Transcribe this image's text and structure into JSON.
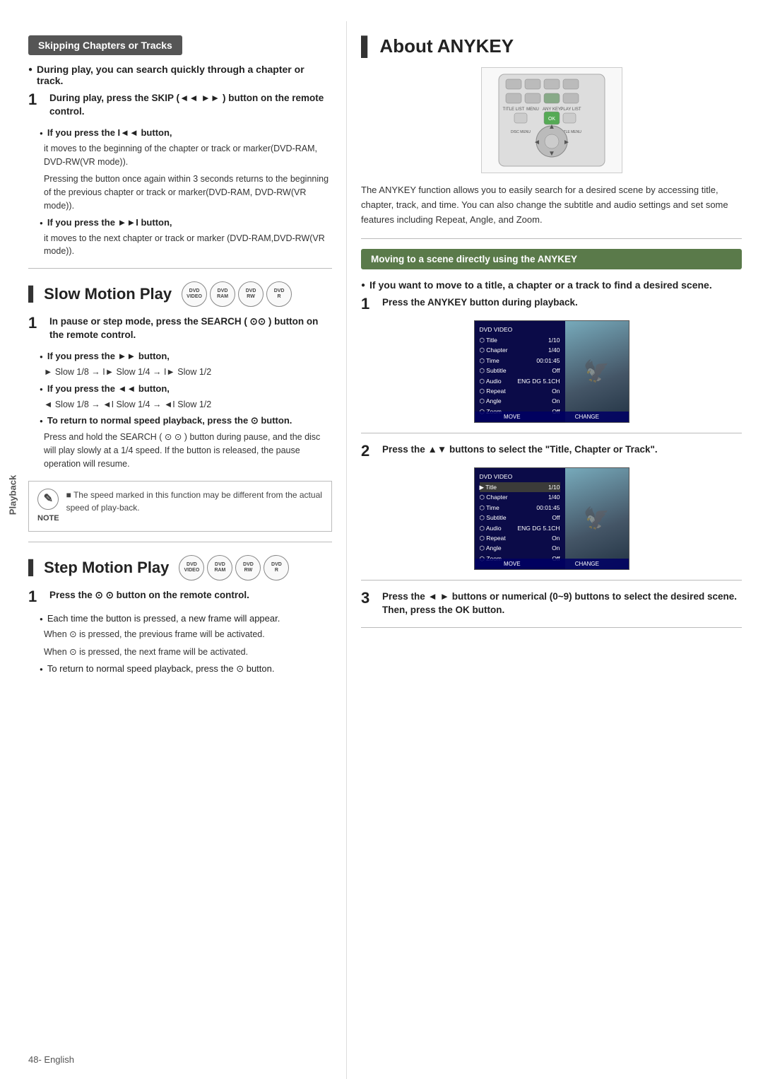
{
  "page": {
    "footer": "48- English",
    "sidebar": "Playback"
  },
  "left": {
    "section1": {
      "header": "Skipping Chapters or Tracks",
      "bullet1": "During play, you can search quickly through a chapter or track.",
      "step1": {
        "num": "1",
        "text_bold": "During play, press the SKIP (◄◄ ►► ) button on the remote control.",
        "sub1_label": "If you press the I◄◄ button,",
        "sub1_text1": "it moves to the beginning of the chapter or track or marker(DVD-RAM, DVD-RW(VR mode)).",
        "sub1_text2": "Pressing the button once again within 3 seconds returns to the beginning of the previous chapter or track or marker(DVD-RAM, DVD-RW(VR mode)).",
        "sub2_label": "If you press the ►►I button,",
        "sub2_text": "it moves to the next chapter or track or marker (DVD-RAM,DVD-RW(VR mode))."
      }
    },
    "section2": {
      "title": "Slow Motion Play",
      "disc_labels": [
        "DVD-VIDEO",
        "DVD-RAM",
        "DVD-RW",
        "DVD-R"
      ],
      "step1": {
        "num": "1",
        "text": "In pause or step mode, press the SEARCH ( ⊙⊙ ) button on the remote control.",
        "sub1_label": "If you press the ►► button,",
        "sub1_text": "► Slow 1/8 → I► Slow 1/4 → I► Slow 1/2",
        "sub2_label": "If you press the ◄◄ button,",
        "sub2_text": "◄ Slow 1/8 → ◄I Slow 1/4 → ◄I Slow 1/2",
        "sub3_label": "To return to normal speed playback, press the ⊙ button."
      },
      "body_text": "Press and hold the SEARCH ( ⊙ ⊙ ) button during pause, and the disc will play slowly at a 1/4 speed. If the button is released, the pause operation will resume.",
      "note": {
        "icon": "✎",
        "label": "NOTE",
        "bullet1": "The speed marked in this function may be different from the actual speed of play-back."
      }
    },
    "section3": {
      "title": "Step Motion Play",
      "disc_labels": [
        "DVD-VIDEO",
        "DVD-RAM",
        "DVD-RW",
        "DVD-R"
      ],
      "step1": {
        "num": "1",
        "text": "Press the ⊙ ⊙ button on the remote control.",
        "sub1_text1": "Each time the button is pressed, a new frame will appear.",
        "sub1_text2": "When ⊙ is pressed, the previous frame will be activated.",
        "sub1_text3": "When ⊙ is pressed, the next frame will be activated.",
        "sub2_text": "To return to normal speed playback, press the ⊙ button."
      }
    }
  },
  "right": {
    "title": "About ANYKEY",
    "description": "The ANYKEY function allows you to easily search for a desired scene by accessing title, chapter, track, and time. You can also change the subtitle and audio settings and set some features including Repeat, Angle, and Zoom.",
    "section_header": "Moving to a scene directly using the ANYKEY",
    "bullet1": "If you want to move to a title, a chapter or a track to find a desired scene.",
    "step1": {
      "num": "1",
      "text": "Press the ANYKEY button during playback."
    },
    "step2": {
      "num": "2",
      "text": "Press the ▲▼ buttons to select the \"Title, Chapter or Track\"."
    },
    "step3": {
      "num": "3",
      "text": "Press the ◄ ► buttons or numerical (0~9) buttons to select the desired scene. Then, press the OK button."
    },
    "screen1": {
      "rows": [
        {
          "label": "Title",
          "value": "1/10"
        },
        {
          "label": "Chapter",
          "value": "1/40"
        },
        {
          "label": "Time",
          "value": "00:01:45"
        },
        {
          "label": "Subtitle",
          "value": "Off"
        },
        {
          "label": "Audio",
          "value": "ENG DG 5.1CH"
        },
        {
          "label": "Repeat",
          "value": "On"
        },
        {
          "label": "Angle",
          "value": "On"
        },
        {
          "label": "Zoom",
          "value": "Off"
        }
      ],
      "bar_left": "MOVE",
      "bar_right": "CHANGE"
    },
    "screen2": {
      "rows": [
        {
          "label": "Title",
          "value": "1/10"
        },
        {
          "label": "Chapter",
          "value": "1/40"
        },
        {
          "label": "Time",
          "value": "00:01:45"
        },
        {
          "label": "Subtitle",
          "value": "Off"
        },
        {
          "label": "Audio",
          "value": "ENG DG 5.1CH"
        },
        {
          "label": "Repeat",
          "value": "On"
        },
        {
          "label": "Angle",
          "value": "On"
        },
        {
          "label": "Zoom",
          "value": "Off"
        }
      ],
      "bar_left": "MOVE",
      "bar_right": "CHANGE"
    }
  }
}
